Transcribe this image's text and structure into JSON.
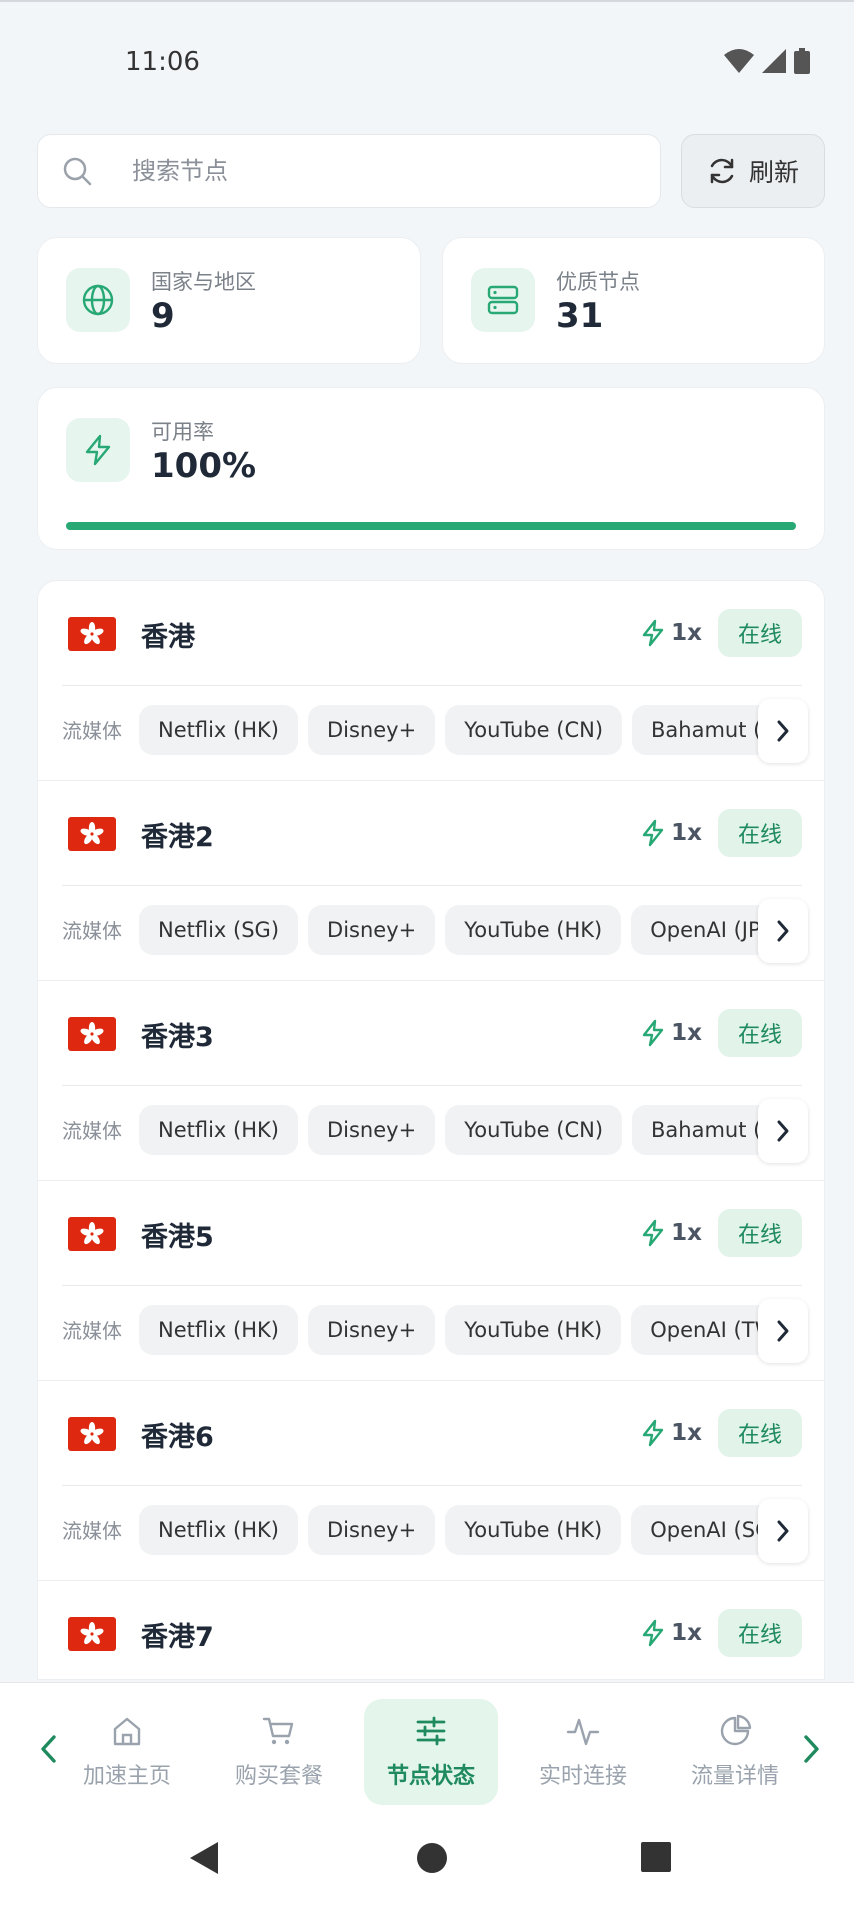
{
  "status_bar": {
    "time": "11:06"
  },
  "search": {
    "placeholder": "搜索节点",
    "refresh_label": "刷新"
  },
  "stats": {
    "countries": {
      "label": "国家与地区",
      "value": "9"
    },
    "quality_nodes": {
      "label": "优质节点",
      "value": "31"
    },
    "availability": {
      "label": "可用率",
      "value": "100%",
      "progress_fraction": 1.0
    }
  },
  "media_label": "流媒体",
  "nodes": [
    {
      "name": "香港",
      "multiplier": "1x",
      "status": "在线",
      "media": [
        "Netflix (HK)",
        "Disney+",
        "YouTube (CN)",
        "Bahamut (TW)"
      ]
    },
    {
      "name": "香港2",
      "multiplier": "1x",
      "status": "在线",
      "media": [
        "Netflix (SG)",
        "Disney+",
        "YouTube (HK)",
        "OpenAI (JP)"
      ]
    },
    {
      "name": "香港3",
      "multiplier": "1x",
      "status": "在线",
      "media": [
        "Netflix (HK)",
        "Disney+",
        "YouTube (CN)",
        "Bahamut (TW)"
      ]
    },
    {
      "name": "香港5",
      "multiplier": "1x",
      "status": "在线",
      "media": [
        "Netflix (HK)",
        "Disney+",
        "YouTube (HK)",
        "OpenAI (TW)"
      ]
    },
    {
      "name": "香港6",
      "multiplier": "1x",
      "status": "在线",
      "media": [
        "Netflix (HK)",
        "Disney+",
        "YouTube (HK)",
        "OpenAI (SG)"
      ]
    },
    {
      "name": "香港7",
      "multiplier": "1x",
      "status": "在线",
      "media": []
    }
  ],
  "bottom_nav": {
    "items": [
      {
        "label": "加速主页",
        "icon": "home-icon"
      },
      {
        "label": "购买套餐",
        "icon": "cart-icon"
      },
      {
        "label": "节点状态",
        "icon": "sliders-icon",
        "active": true
      },
      {
        "label": "实时连接",
        "icon": "activity-icon"
      },
      {
        "label": "流量详情",
        "icon": "pie-chart-icon"
      }
    ]
  },
  "colors": {
    "accent": "#1e8a5d",
    "accent_bg": "#e4f5ec",
    "flag_red": "#de2910",
    "progress": "#27a874"
  }
}
